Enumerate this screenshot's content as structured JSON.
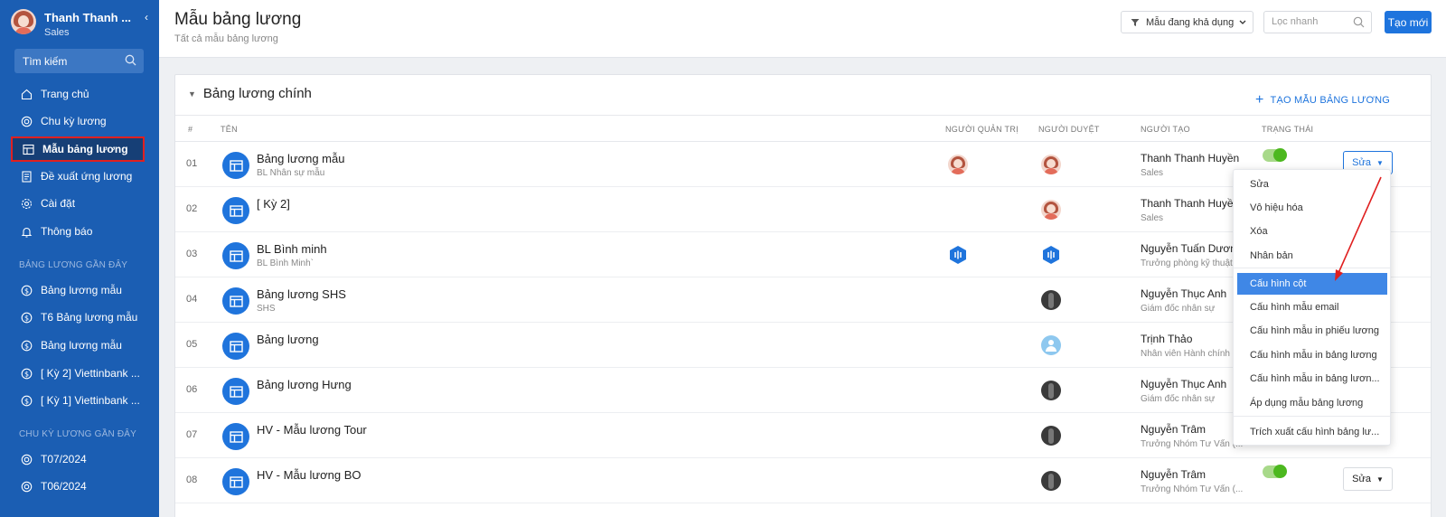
{
  "sidebar": {
    "user_name": "Thanh Thanh ...",
    "user_role": "Sales",
    "collapse_glyph": "‹",
    "search_label": "Tìm kiếm",
    "items": [
      {
        "label": "Trang chủ",
        "icon": "home-icon"
      },
      {
        "label": "Chu kỳ lương",
        "icon": "cycle-icon"
      },
      {
        "label": "Mẫu bảng lương",
        "icon": "table-icon",
        "active": true
      },
      {
        "label": "Đề xuất ứng lương",
        "icon": "document-icon"
      },
      {
        "label": "Cài đặt",
        "icon": "gear-icon"
      },
      {
        "label": "Thông báo",
        "icon": "bell-icon"
      }
    ],
    "recent_payroll_title": "BẢNG LƯƠNG GẦN ĐÂY",
    "recent_payroll": [
      "Bảng lương mẫu",
      "T6 Bảng lương mẫu",
      "Bảng lương mẫu",
      "[ Kỳ 2] Viettinbank ...",
      "[ Kỳ 1] Viettinbank ..."
    ],
    "recent_cycle_title": "CHU KỲ LƯƠNG GẦN ĐÂY",
    "recent_cycles": [
      "T07/2024",
      "T06/2024"
    ]
  },
  "header": {
    "title": "Mẫu bảng lương",
    "subtitle": "Tất cả mẫu bảng lương",
    "filter_label": "Mẫu đang khả dụng",
    "search_placeholder": "Lọc nhanh",
    "create_label": "Tạo mới"
  },
  "card": {
    "title": "Bảng lương chính",
    "add_label": "TẠO MẪU BẢNG LƯƠNG",
    "columns": {
      "num": "#",
      "name": "TÊN",
      "admin": "NGƯỜI QUẢN TRỊ",
      "approver": "NGƯỜI DUYỆT",
      "creator": "NGƯỜI TẠO",
      "status": "TRẠNG THÁI"
    },
    "edit_label": "Sửa",
    "rows": [
      {
        "num": "01",
        "name": "Bảng lương mẫu",
        "desc": "BL Nhân sự mẫu",
        "creator": "Thanh Thanh Huyền",
        "creator_sub": "Sales",
        "admin": "person",
        "approver": "person",
        "active": true,
        "edit_open": true
      },
      {
        "num": "02",
        "name": "[ Kỳ 2]",
        "desc": "",
        "creator": "Thanh Thanh Huyền",
        "creator_sub": "Sales",
        "admin": "",
        "approver": "person"
      },
      {
        "num": "03",
        "name": "BL Bình minh",
        "desc": "BL Bình Minh`",
        "creator": "Nguyễn Tuấn Dương",
        "creator_sub": "Trưởng phòng kỹ thuật",
        "admin": "hex",
        "approver": "hex"
      },
      {
        "num": "04",
        "name": "Bảng lương SHS",
        "desc": "SHS",
        "creator": "Nguyễn Thục Anh",
        "creator_sub": "Giám đốc nhân sự",
        "admin": "",
        "approver": "dark"
      },
      {
        "num": "05",
        "name": "Bảng lương",
        "desc": "",
        "creator": "Trịnh Thảo",
        "creator_sub": "Nhân viên Hành chính n",
        "admin": "",
        "approver": "default"
      },
      {
        "num": "06",
        "name": "Bảng lương Hưng",
        "desc": "",
        "creator": "Nguyễn Thục Anh",
        "creator_sub": "Giám đốc nhân sự",
        "admin": "",
        "approver": "dark"
      },
      {
        "num": "07",
        "name": "HV - Mẫu lương Tour",
        "desc": "",
        "creator": "Nguyễn Trâm",
        "creator_sub": "Trưởng Nhóm Tư Vấn (...",
        "admin": "",
        "approver": "dark"
      },
      {
        "num": "08",
        "name": "HV - Mẫu lương BO",
        "desc": "",
        "creator": "Nguyễn Trâm",
        "creator_sub": "Trưởng Nhóm Tư Vấn (...",
        "admin": "",
        "approver": "dark",
        "active": true,
        "show_edit": true
      }
    ]
  },
  "dropdown": {
    "items": [
      "Sửa",
      "Vô hiệu hóa",
      "Xóa",
      "Nhân bản",
      "Cấu hình cột",
      "Cấu hình mẫu email",
      "Cấu hình mẫu in phiếu lương",
      "Cấu hình mẫu in bảng lương",
      "Cấu hình mẫu in bảng lươn...",
      "Áp dụng mẫu bảng lương",
      "Trích xuất cấu hình bảng lư..."
    ],
    "highlighted": "Cấu hình cột"
  },
  "colors": {
    "sidebar": "#1b5eb3",
    "accent": "#1e74dd",
    "highlight": "#3f87e6",
    "annotation": "#e02020",
    "toggle_on": "#4cb81f"
  }
}
